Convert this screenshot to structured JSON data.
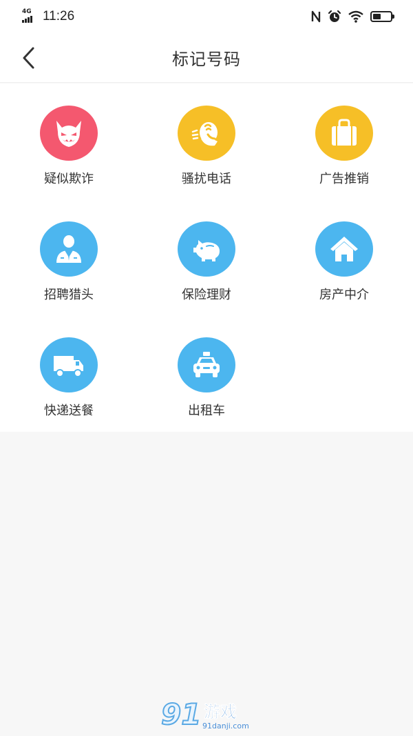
{
  "status_bar": {
    "network": "4G",
    "time": "11:26",
    "battery_level": 0.45
  },
  "nav": {
    "title": "标记号码",
    "back_icon": "chevron-left-icon"
  },
  "categories": [
    {
      "label": "疑似欺诈",
      "icon": "devil-face-icon",
      "color": "#f4586f"
    },
    {
      "label": "骚扰电话",
      "icon": "phone-call-icon",
      "color": "#f6bf27"
    },
    {
      "label": "广告推销",
      "icon": "shopping-bag-icon",
      "color": "#f6bf27"
    },
    {
      "label": "招聘猎头",
      "icon": "businessman-icon",
      "color": "#4cb6ef"
    },
    {
      "label": "保险理财",
      "icon": "piggy-bank-icon",
      "color": "#4cb6ef"
    },
    {
      "label": "房产中介",
      "icon": "house-icon",
      "color": "#4cb6ef"
    },
    {
      "label": "快递送餐",
      "icon": "delivery-truck-icon",
      "color": "#4cb6ef"
    },
    {
      "label": "出租车",
      "icon": "taxi-icon",
      "color": "#4cb6ef"
    }
  ],
  "watermark": {
    "logo_text": "91",
    "brand": "游戏",
    "site": "91danji.com"
  }
}
